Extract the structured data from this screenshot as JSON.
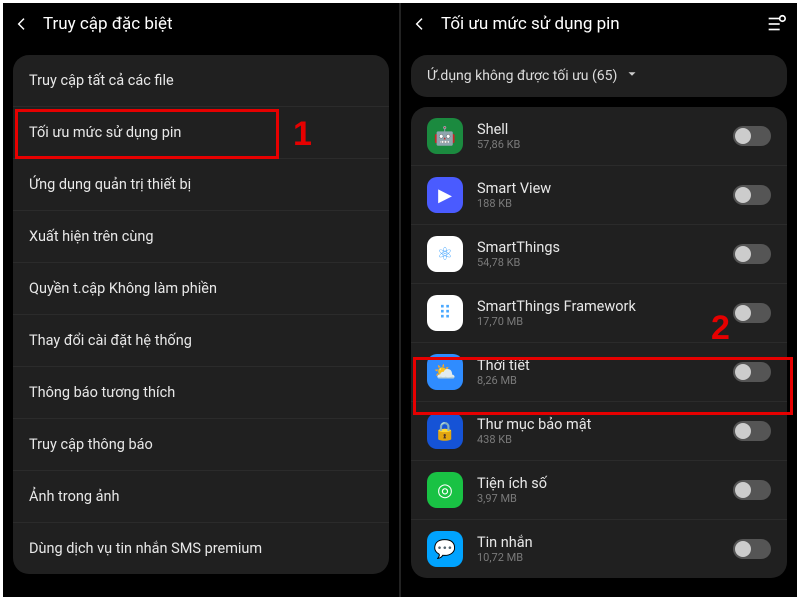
{
  "left": {
    "title": "Truy cập đặc biệt",
    "items": [
      "Truy cập tất cả các file",
      "Tối ưu mức sử dụng pin",
      "Ứng dụng quản trị thiết bị",
      "Xuất hiện trên cùng",
      "Quyền t.cập Không làm phiền",
      "Thay đổi cài đặt hệ thống",
      "Thông báo tương thích",
      "Truy cập thông báo",
      "Ảnh trong ảnh",
      "Dùng dịch vụ tin nhắn SMS premium"
    ]
  },
  "right": {
    "title": "Tối ưu mức sử dụng pin",
    "filter": "Ứ.dụng không được tối ưu (65)",
    "apps": [
      {
        "name": "Shell",
        "size": "57,86 KB",
        "icon_bg": "#1b8a3f",
        "icon_glyph": "🤖"
      },
      {
        "name": "Smart View",
        "size": "188 KB",
        "icon_bg": "#4a5bff",
        "icon_glyph": "▶"
      },
      {
        "name": "SmartThings",
        "size": "54,78 KB",
        "icon_bg": "#ffffff",
        "icon_glyph": "⚛"
      },
      {
        "name": "SmartThings Framework",
        "size": "17,70 MB",
        "icon_bg": "#ffffff",
        "icon_glyph": "⠿"
      },
      {
        "name": "Thời tiết",
        "size": "8,26 MB",
        "icon_bg": "#2f8cff",
        "icon_glyph": "⛅"
      },
      {
        "name": "Thư mục bảo mật",
        "size": "438 KB",
        "icon_bg": "#1553d6",
        "icon_glyph": "🔒"
      },
      {
        "name": "Tiện ích số",
        "size": "3,97 MB",
        "icon_bg": "#19c244",
        "icon_glyph": "◎"
      },
      {
        "name": "Tin nhắn",
        "size": "10,72 MB",
        "icon_bg": "#00a3ff",
        "icon_glyph": "💬"
      }
    ]
  },
  "callouts": {
    "one": "1",
    "two": "2"
  }
}
